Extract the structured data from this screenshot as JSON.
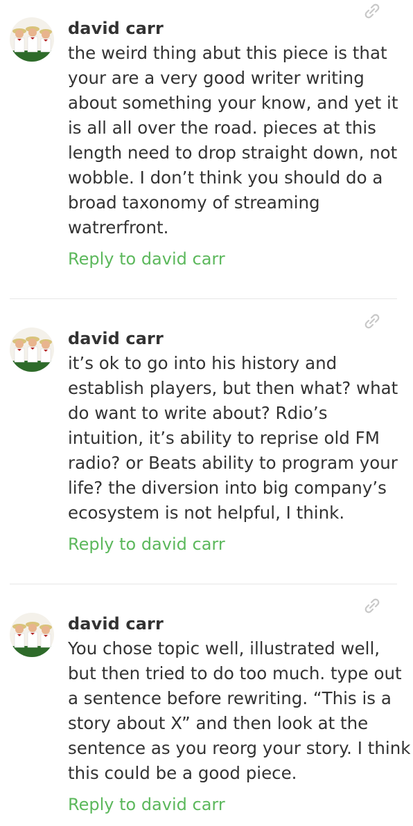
{
  "comments": [
    {
      "author": "david carr",
      "lines": [
        "the weird thing abut this piece is that",
        "your are a very good writer writing",
        "about something your know, and yet it",
        "is all all over the road. pieces at this",
        "length need to drop straight down, not",
        "wobble. I don’t think you should do a",
        "broad taxonomy of streaming",
        "watrerfront."
      ],
      "reply_label": "Reply to david carr",
      "avatar_icon": "avatar-group-photo",
      "link_icon": "link-icon"
    },
    {
      "author": "david carr",
      "lines": [
        "it’s ok to go into his history and",
        "establish players, but then what? what",
        "do want to write about? Rdio’s",
        "intuition, it’s ability to reprise old FM",
        "radio? or Beats ability to program your",
        "life? the diversion into big company’s",
        "ecosystem is not helpful, I think."
      ],
      "reply_label": "Reply to david carr",
      "avatar_icon": "avatar-group-photo",
      "link_icon": "link-icon"
    },
    {
      "author": "david carr",
      "lines": [
        "You chose topic well, illustrated well,",
        "but then tried to do too much. type out",
        "a sentence before rewriting. “This is a",
        "story about X” and then look at the",
        "sentence as you reorg your story. I think",
        "this could be a good piece."
      ],
      "reply_label": "Reply to david carr",
      "avatar_icon": "avatar-group-photo",
      "link_icon": "link-icon"
    }
  ],
  "colors": {
    "text": "#333333",
    "reply": "#5cb85c",
    "divider": "#e6e6e6",
    "icon": "#c8c8c8"
  }
}
